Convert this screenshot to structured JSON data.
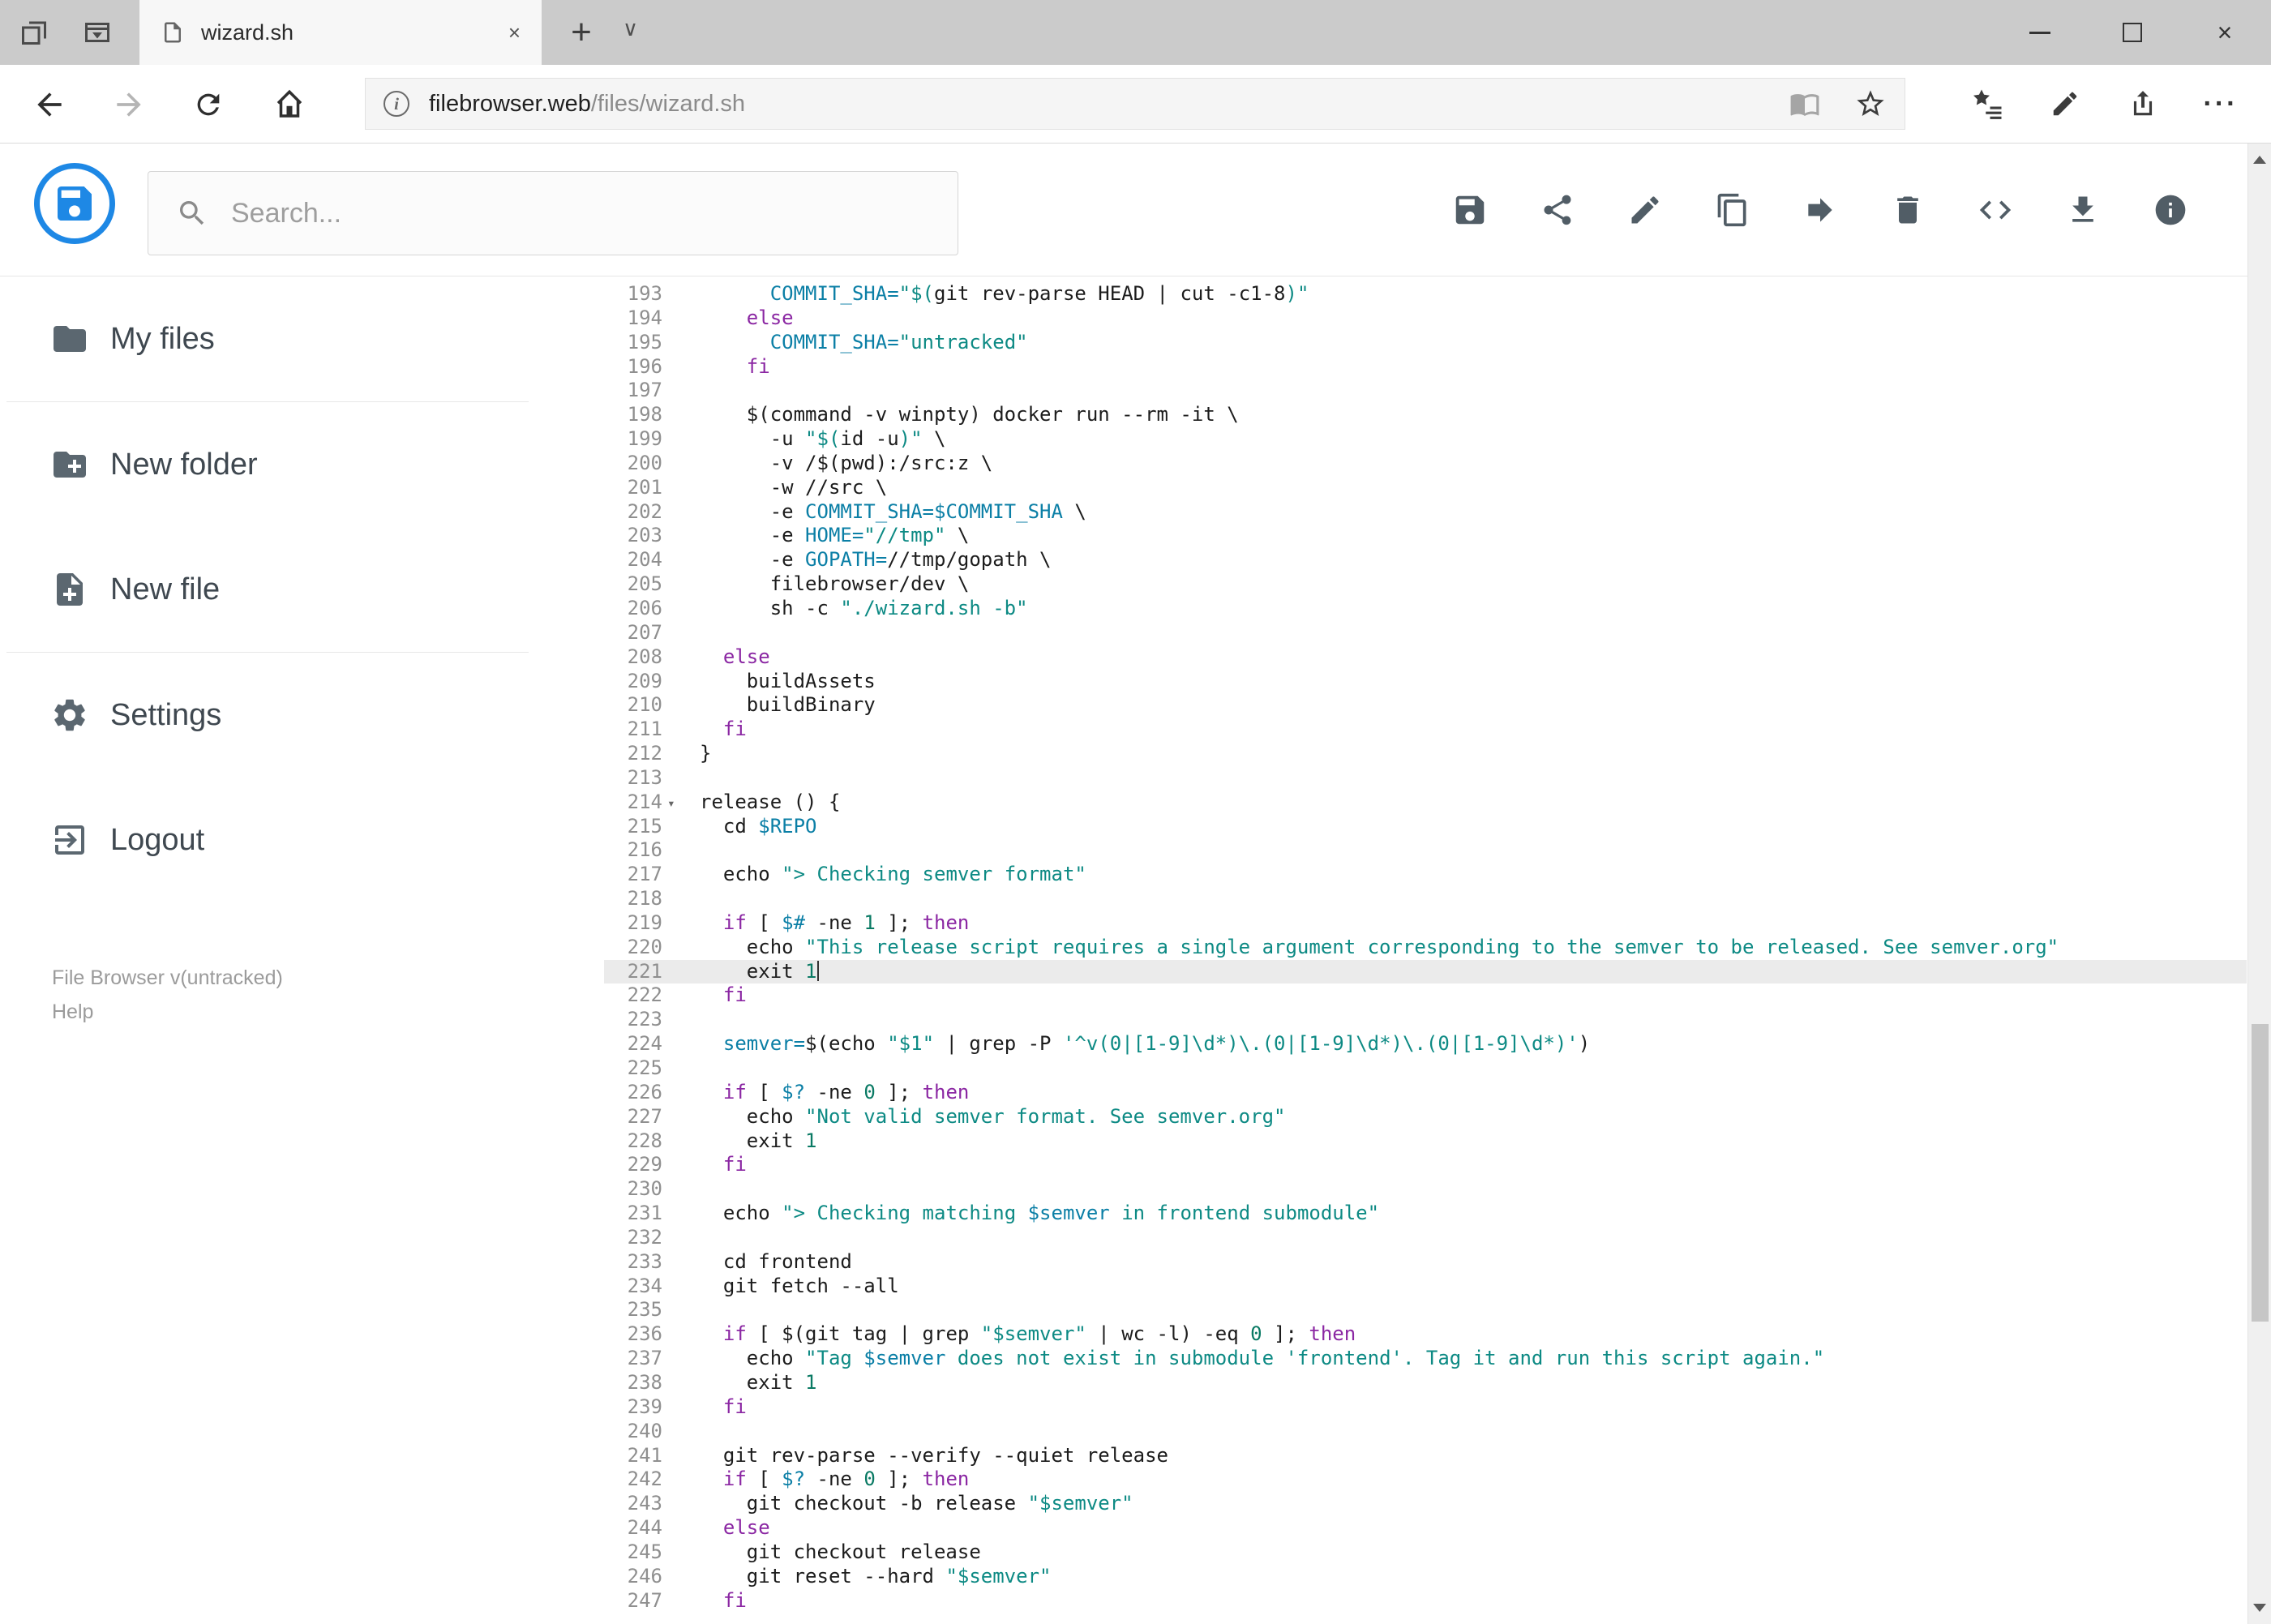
{
  "browser": {
    "tab": {
      "title": "wizard.sh"
    },
    "address": {
      "host": "filebrowser.web",
      "path": "/files/wizard.sh"
    }
  },
  "icons": {
    "close": "×",
    "new_tab": "+",
    "chevron_down": "∨",
    "more": "···",
    "info": "i"
  },
  "header": {
    "search_placeholder": "Search...",
    "toolbar_icons": [
      "save",
      "share",
      "rename",
      "copy",
      "move",
      "delete",
      "code",
      "download",
      "info"
    ]
  },
  "sidebar": {
    "items": [
      {
        "label": "My files"
      },
      {
        "label": "New folder"
      },
      {
        "label": "New file"
      },
      {
        "label": "Settings"
      },
      {
        "label": "Logout"
      }
    ],
    "footer": {
      "version": "File Browser v(untracked)",
      "help": "Help"
    }
  },
  "editor": {
    "active_line": 221,
    "cursor_line": 221,
    "folded_line": 214,
    "fold_glyph": "▾",
    "lines": [
      {
        "n": 193,
        "t": [
          [
            "p",
            "      "
          ],
          [
            "v",
            "COMMIT_SHA="
          ],
          [
            "s",
            "\"$("
          ],
          [
            "p",
            "git rev-parse HEAD | cut -c1-8"
          ],
          [
            "s",
            ")\""
          ]
        ]
      },
      {
        "n": 194,
        "t": [
          [
            "p",
            "    "
          ],
          [
            "k",
            "else"
          ]
        ]
      },
      {
        "n": 195,
        "t": [
          [
            "p",
            "      "
          ],
          [
            "v",
            "COMMIT_SHA="
          ],
          [
            "s",
            "\"untracked\""
          ]
        ]
      },
      {
        "n": 196,
        "t": [
          [
            "p",
            "    "
          ],
          [
            "k",
            "fi"
          ]
        ]
      },
      {
        "n": 197,
        "t": []
      },
      {
        "n": 198,
        "t": [
          [
            "p",
            "    $(command -v winpty) docker run --rm -it \\"
          ]
        ]
      },
      {
        "n": 199,
        "t": [
          [
            "p",
            "      -u "
          ],
          [
            "s",
            "\"$("
          ],
          [
            "p",
            "id -u"
          ],
          [
            "s",
            ")\""
          ],
          [
            "p",
            " \\"
          ]
        ]
      },
      {
        "n": 200,
        "t": [
          [
            "p",
            "      -v /$(pwd):/src:z \\"
          ]
        ]
      },
      {
        "n": 201,
        "t": [
          [
            "p",
            "      -w //src \\"
          ]
        ]
      },
      {
        "n": 202,
        "t": [
          [
            "p",
            "      -e "
          ],
          [
            "v",
            "COMMIT_SHA=$COMMIT_SHA"
          ],
          [
            "p",
            " \\"
          ]
        ]
      },
      {
        "n": 203,
        "t": [
          [
            "p",
            "      -e "
          ],
          [
            "v",
            "HOME="
          ],
          [
            "s",
            "\"//tmp\""
          ],
          [
            "p",
            " \\"
          ]
        ]
      },
      {
        "n": 204,
        "t": [
          [
            "p",
            "      -e "
          ],
          [
            "v",
            "GOPATH="
          ],
          [
            "p",
            "//tmp/gopath \\"
          ]
        ]
      },
      {
        "n": 205,
        "t": [
          [
            "p",
            "      filebrowser/dev \\"
          ]
        ]
      },
      {
        "n": 206,
        "t": [
          [
            "p",
            "      sh -c "
          ],
          [
            "s",
            "\"./wizard.sh -b\""
          ]
        ]
      },
      {
        "n": 207,
        "t": []
      },
      {
        "n": 208,
        "t": [
          [
            "p",
            "  "
          ],
          [
            "k",
            "else"
          ]
        ]
      },
      {
        "n": 209,
        "t": [
          [
            "p",
            "    buildAssets"
          ]
        ]
      },
      {
        "n": 210,
        "t": [
          [
            "p",
            "    buildBinary"
          ]
        ]
      },
      {
        "n": 211,
        "t": [
          [
            "p",
            "  "
          ],
          [
            "k",
            "fi"
          ]
        ]
      },
      {
        "n": 212,
        "t": [
          [
            "p",
            "}"
          ]
        ]
      },
      {
        "n": 213,
        "t": []
      },
      {
        "n": 214,
        "t": [
          [
            "p",
            "release () {"
          ]
        ]
      },
      {
        "n": 215,
        "t": [
          [
            "p",
            "  cd "
          ],
          [
            "v",
            "$REPO"
          ]
        ]
      },
      {
        "n": 216,
        "t": []
      },
      {
        "n": 217,
        "t": [
          [
            "p",
            "  echo "
          ],
          [
            "s",
            "\"> Checking semver format\""
          ]
        ]
      },
      {
        "n": 218,
        "t": []
      },
      {
        "n": 219,
        "t": [
          [
            "p",
            "  "
          ],
          [
            "k",
            "if"
          ],
          [
            "p",
            " [ "
          ],
          [
            "v",
            "$#"
          ],
          [
            "p",
            " -ne "
          ],
          [
            "n2",
            "1"
          ],
          [
            "p",
            " ]; "
          ],
          [
            "k",
            "then"
          ]
        ]
      },
      {
        "n": 220,
        "t": [
          [
            "p",
            "    echo "
          ],
          [
            "s",
            "\"This release script requires a single argument corresponding to the semver to be released. See semver.org\""
          ]
        ]
      },
      {
        "n": 221,
        "t": [
          [
            "p",
            "    exit "
          ],
          [
            "n2",
            "1"
          ]
        ]
      },
      {
        "n": 222,
        "t": [
          [
            "p",
            "  "
          ],
          [
            "k",
            "fi"
          ]
        ]
      },
      {
        "n": 223,
        "t": []
      },
      {
        "n": 224,
        "t": [
          [
            "p",
            "  "
          ],
          [
            "v",
            "semver="
          ],
          [
            "p",
            "$(echo "
          ],
          [
            "s",
            "\"$1\""
          ],
          [
            "p",
            " | grep -P "
          ],
          [
            "s",
            "'^v(0|[1-9]\\d*)\\.(0|[1-9]\\d*)\\.(0|[1-9]\\d*)'"
          ],
          [
            "p",
            ")"
          ]
        ]
      },
      {
        "n": 225,
        "t": []
      },
      {
        "n": 226,
        "t": [
          [
            "p",
            "  "
          ],
          [
            "k",
            "if"
          ],
          [
            "p",
            " [ "
          ],
          [
            "v",
            "$?"
          ],
          [
            "p",
            " -ne "
          ],
          [
            "n2",
            "0"
          ],
          [
            "p",
            " ]; "
          ],
          [
            "k",
            "then"
          ]
        ]
      },
      {
        "n": 227,
        "t": [
          [
            "p",
            "    echo "
          ],
          [
            "s",
            "\"Not valid semver format. See semver.org\""
          ]
        ]
      },
      {
        "n": 228,
        "t": [
          [
            "p",
            "    exit "
          ],
          [
            "n2",
            "1"
          ]
        ]
      },
      {
        "n": 229,
        "t": [
          [
            "p",
            "  "
          ],
          [
            "k",
            "fi"
          ]
        ]
      },
      {
        "n": 230,
        "t": []
      },
      {
        "n": 231,
        "t": [
          [
            "p",
            "  echo "
          ],
          [
            "s",
            "\"> Checking matching "
          ],
          [
            "v",
            "$semver"
          ],
          [
            "s",
            " in frontend submodule\""
          ]
        ]
      },
      {
        "n": 232,
        "t": []
      },
      {
        "n": 233,
        "t": [
          [
            "p",
            "  cd frontend"
          ]
        ]
      },
      {
        "n": 234,
        "t": [
          [
            "p",
            "  git fetch --all"
          ]
        ]
      },
      {
        "n": 235,
        "t": []
      },
      {
        "n": 236,
        "t": [
          [
            "p",
            "  "
          ],
          [
            "k",
            "if"
          ],
          [
            "p",
            " [ $(git tag | grep "
          ],
          [
            "s",
            "\"$semver\""
          ],
          [
            "p",
            " | wc -l) -eq "
          ],
          [
            "n2",
            "0"
          ],
          [
            "p",
            " ]; "
          ],
          [
            "k",
            "then"
          ]
        ]
      },
      {
        "n": 237,
        "t": [
          [
            "p",
            "    echo "
          ],
          [
            "s",
            "\"Tag "
          ],
          [
            "v",
            "$semver"
          ],
          [
            "s",
            " does not exist in submodule 'frontend'. Tag it and run this script again.\""
          ]
        ]
      },
      {
        "n": 238,
        "t": [
          [
            "p",
            "    exit "
          ],
          [
            "n2",
            "1"
          ]
        ]
      },
      {
        "n": 239,
        "t": [
          [
            "p",
            "  "
          ],
          [
            "k",
            "fi"
          ]
        ]
      },
      {
        "n": 240,
        "t": []
      },
      {
        "n": 241,
        "t": [
          [
            "p",
            "  git rev-parse --verify --quiet release"
          ]
        ]
      },
      {
        "n": 242,
        "t": [
          [
            "p",
            "  "
          ],
          [
            "k",
            "if"
          ],
          [
            "p",
            " [ "
          ],
          [
            "v",
            "$?"
          ],
          [
            "p",
            " -ne "
          ],
          [
            "n2",
            "0"
          ],
          [
            "p",
            " ]; "
          ],
          [
            "k",
            "then"
          ]
        ]
      },
      {
        "n": 243,
        "t": [
          [
            "p",
            "    git checkout -b release "
          ],
          [
            "s",
            "\"$semver\""
          ]
        ]
      },
      {
        "n": 244,
        "t": [
          [
            "p",
            "  "
          ],
          [
            "k",
            "else"
          ]
        ]
      },
      {
        "n": 245,
        "t": [
          [
            "p",
            "    git checkout release"
          ]
        ]
      },
      {
        "n": 246,
        "t": [
          [
            "p",
            "    git reset --hard "
          ],
          [
            "s",
            "\"$semver\""
          ]
        ]
      },
      {
        "n": 247,
        "t": [
          [
            "p",
            "  "
          ],
          [
            "k",
            "fi"
          ]
        ]
      }
    ]
  }
}
